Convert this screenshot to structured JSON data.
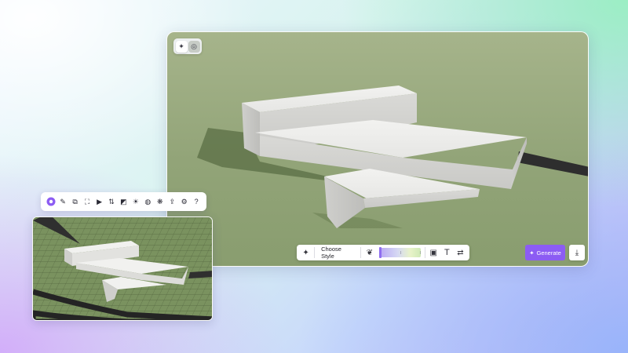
{
  "main_view": {
    "toolbar": {
      "style_label": "Choose Style",
      "icons": [
        "sparkle-icon",
        "palette-icon",
        "image-icon",
        "text-icon",
        "sliders-icon"
      ]
    },
    "generate_label": "Generate",
    "mode_toggle": {
      "active": "sparkle-icon",
      "inactive": "target-icon"
    }
  },
  "tool_palette": {
    "icons": [
      "logo-icon",
      "pen-tool-icon",
      "layers-icon",
      "camera-frame-icon",
      "video-icon",
      "transform-icon",
      "image-edit-icon",
      "lightbulb-icon",
      "material-icon",
      "effects-icon",
      "export-icon",
      "settings-icon",
      "help-icon"
    ]
  },
  "colors": {
    "accent": "#8c5cf3",
    "terrain": "#92a478",
    "road": "#2b2b2b",
    "building": "#e8e8e6"
  }
}
